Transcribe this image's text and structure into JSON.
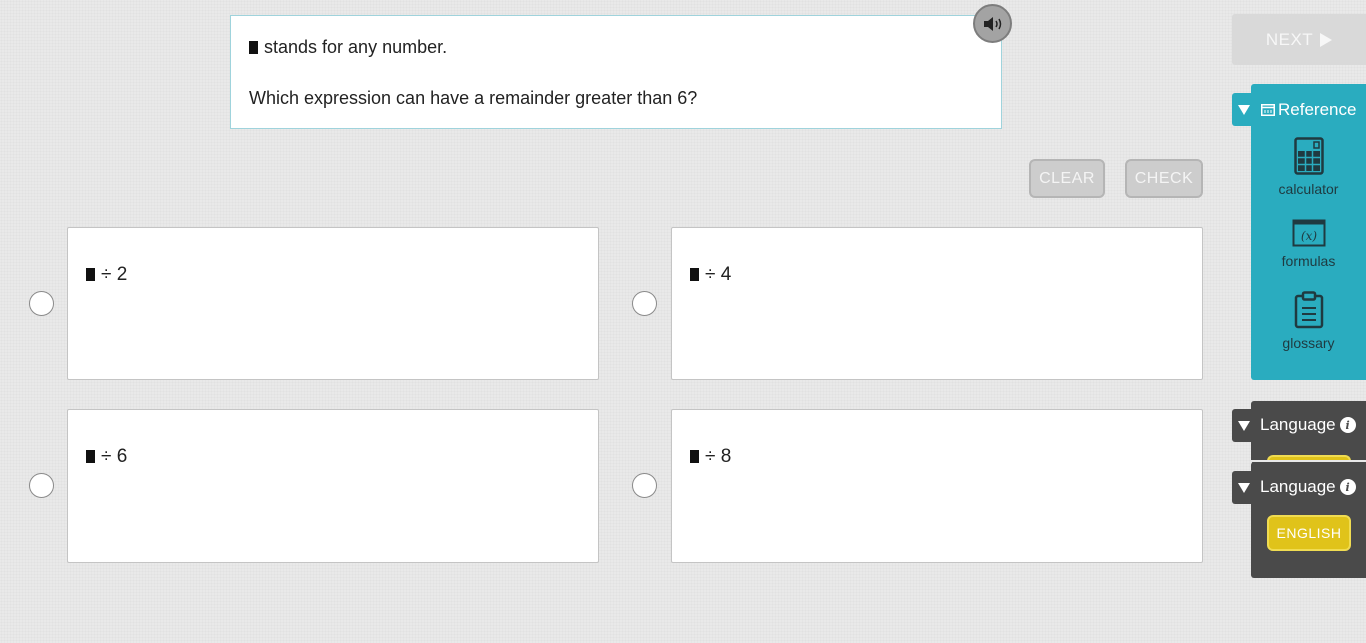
{
  "question": {
    "line1": "stands for any number.",
    "line2": "Which expression can have a remainder greater than 6?"
  },
  "audio_icon": "speaker-icon",
  "buttons": {
    "clear": "CLEAR",
    "check": "CHECK",
    "next": "NEXT"
  },
  "options": [
    {
      "text": "÷ 2"
    },
    {
      "text": "÷ 4"
    },
    {
      "text": "÷ 6"
    },
    {
      "text": "÷ 8"
    }
  ],
  "reference": {
    "title": "Reference",
    "tools": [
      {
        "label": "calculator",
        "icon": "calculator-icon"
      },
      {
        "label": "formulas",
        "icon": "formulas-icon"
      },
      {
        "label": "glossary",
        "icon": "clipboard-icon"
      }
    ]
  },
  "language": {
    "title": "Language",
    "button": "ENGLISH"
  },
  "colors": {
    "reference_panel": "#2aacbf",
    "language_panel": "#4a4a4a",
    "english_button": "#e0c31a",
    "question_border": "#9fd3dc"
  }
}
